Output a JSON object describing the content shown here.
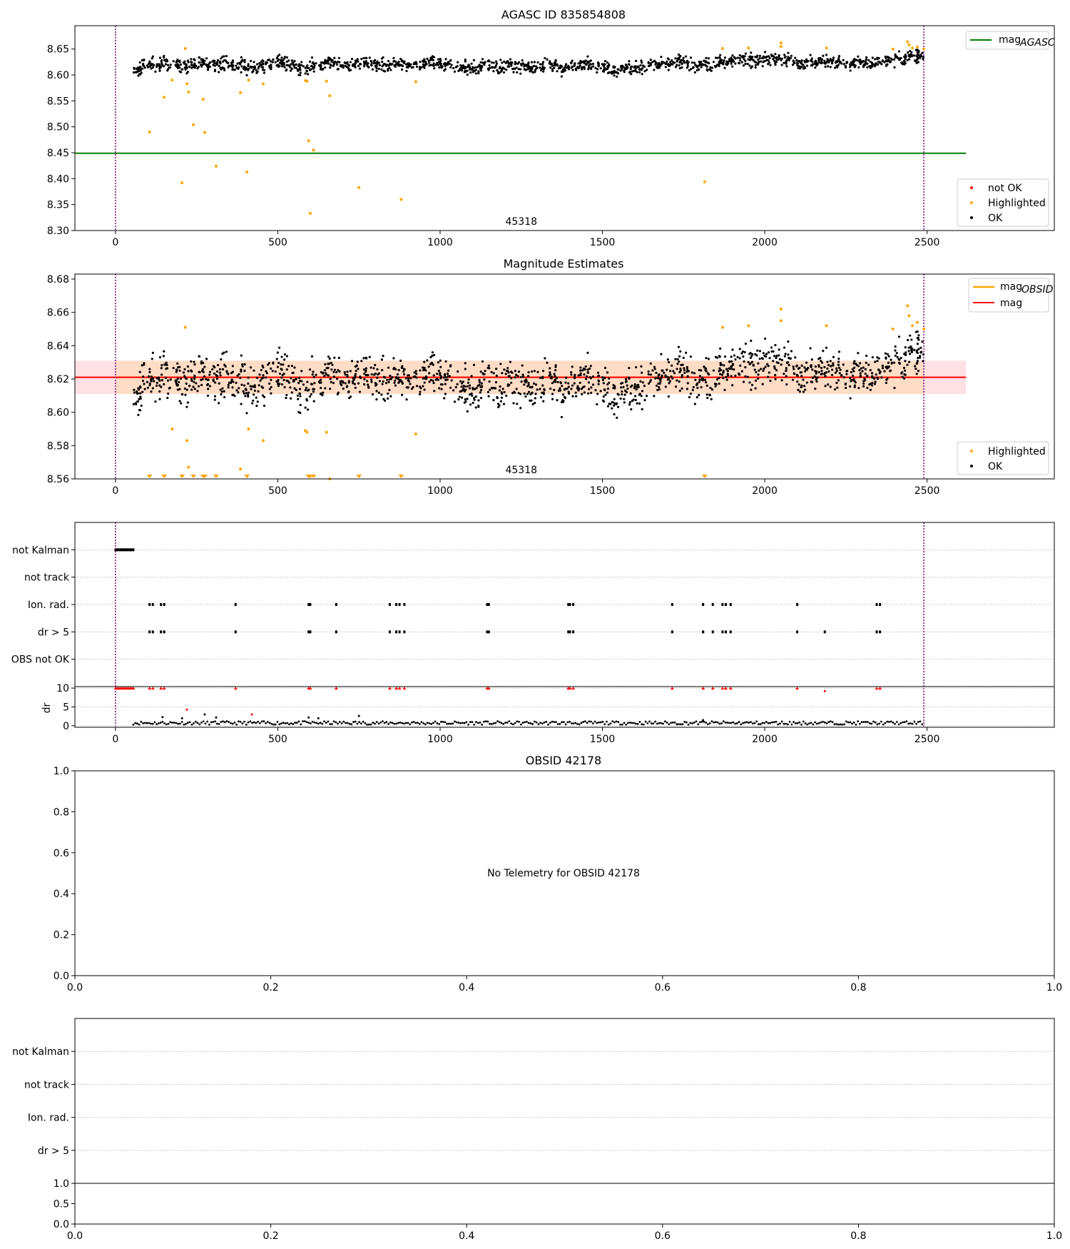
{
  "colors": {
    "ok": "#000000",
    "highlighted": "#ffa500",
    "not_ok": "#ff0000",
    "agasc_line": "#008000",
    "mag_line": "#ff0000",
    "mag_obsid_line": "#ffa500",
    "mag_band": "#ffe0e4",
    "obsid_band": "#ffdcc6",
    "marker_lines": "#800080"
  },
  "chart_data": [
    {
      "type": "scatter",
      "title": "AGASC ID 835854808",
      "annotation": "45318",
      "xlim": [
        -125,
        2892
      ],
      "ylim": [
        8.3,
        8.695
      ],
      "xticks": [
        "0",
        "500",
        "1000",
        "1500",
        "2000",
        "2500"
      ],
      "yticks": [
        "8.30",
        "8.35",
        "8.40",
        "8.45",
        "8.50",
        "8.55",
        "8.60",
        "8.65"
      ],
      "vlines": [
        0,
        2490
      ],
      "hline": {
        "name": "mag_AGASC",
        "label_main": "mag",
        "label_sub": "AGASC",
        "y": 8.449,
        "x": [
          -125,
          2620
        ]
      },
      "legend_points": [
        "not OK",
        "Highlighted",
        "OK"
      ],
      "legend_placement": [
        "top-right",
        "bottom-right"
      ]
    },
    {
      "type": "scatter",
      "title": "Magnitude Estimates",
      "annotation": "45318",
      "xlim": [
        -125,
        2892
      ],
      "ylim": [
        8.56,
        8.683
      ],
      "xticks": [
        "0",
        "500",
        "1000",
        "1500",
        "2000",
        "2500"
      ],
      "yticks": [
        "8.56",
        "8.58",
        "8.60",
        "8.62",
        "8.64",
        "8.66",
        "8.68"
      ],
      "vlines": [
        0,
        2490
      ],
      "mag": {
        "label": "mag",
        "value": 8.621,
        "band": [
          8.611,
          8.631
        ],
        "x": [
          -125,
          2620
        ]
      },
      "mag_obsid": {
        "label_main": "mag",
        "label_sub": "OBSID",
        "value": 8.621,
        "band": [
          8.611,
          8.631
        ],
        "x": [
          0,
          2490
        ]
      },
      "legend_points": [
        "Highlighted",
        "OK"
      ],
      "legend_placement": [
        "top-right",
        "bottom-right"
      ]
    },
    {
      "type": "scatter",
      "title": "",
      "categories": [
        "not Kalman",
        "not track",
        "Ion. rad.",
        "dr > 5",
        "OBS not OK"
      ],
      "xlim": [
        -125,
        2892
      ],
      "xticks": [
        "0",
        "500",
        "1000",
        "1500",
        "2000",
        "2500"
      ],
      "vlines": [
        0,
        2490
      ],
      "flags": {
        "not Kalman": [
          0,
          5,
          10,
          15,
          20,
          25,
          30,
          35,
          40,
          45,
          50,
          55
        ],
        "not track": [],
        "Ion. rad.": [
          105,
          115,
          140,
          150,
          370,
          595,
          600,
          680,
          845,
          865,
          875,
          890,
          1145,
          1150,
          1395,
          1400,
          1410,
          1715,
          1810,
          1840,
          1870,
          1880,
          1895,
          2100,
          2345,
          2355
        ],
        "dr > 5": [
          105,
          115,
          140,
          150,
          370,
          595,
          600,
          680,
          845,
          865,
          875,
          890,
          1145,
          1150,
          1395,
          1400,
          1410,
          1715,
          1810,
          1840,
          1870,
          1880,
          1895,
          2100,
          2185,
          2345,
          2355
        ],
        "OBS not OK": []
      },
      "dr": {
        "ylabel": "dr",
        "ylim": [
          -0.4,
          10.4
        ],
        "yticks": [
          "0",
          "5",
          "10"
        ],
        "ok_points": [
          [
            145,
            2.3
          ],
          [
            205,
            2.0
          ],
          [
            275,
            3.0
          ],
          [
            310,
            2.2
          ],
          [
            595,
            2.2
          ],
          [
            625,
            2.0
          ],
          [
            750,
            2.6
          ],
          [
            1810,
            1.5
          ]
        ],
        "not_ok_points": [
          [
            220,
            4.3
          ],
          [
            420,
            3.0
          ],
          [
            2185,
            9.2
          ]
        ],
        "not_ok_at_max_x": [
          0,
          5,
          10,
          15,
          20,
          25,
          30,
          35,
          40,
          45,
          50,
          55,
          105,
          115,
          140,
          150,
          370,
          595,
          600,
          680,
          845,
          865,
          875,
          890,
          1145,
          1150,
          1395,
          1400,
          1410,
          1715,
          1810,
          1840,
          1870,
          1880,
          1895,
          2100,
          2345,
          2355
        ]
      }
    },
    {
      "type": "scatter",
      "title": "OBSID 42178",
      "annotation": "No Telemetry for OBSID 42178",
      "xlim": [
        0,
        1
      ],
      "ylim": [
        0,
        1
      ],
      "xticks": [
        "0.0",
        "0.2",
        "0.4",
        "0.6",
        "0.8",
        "1.0"
      ],
      "yticks": [
        "0.0",
        "0.2",
        "0.4",
        "0.6",
        "0.8",
        "1.0"
      ]
    },
    {
      "type": "scatter",
      "title": "",
      "categories": [
        "not Kalman",
        "not track",
        "Ion. rad.",
        "dr > 5"
      ],
      "sub": {
        "xlim": [
          0,
          1
        ],
        "ylim": [
          0,
          1
        ],
        "xticks": [
          "0.0",
          "0.2",
          "0.4",
          "0.6",
          "0.8",
          "1.0"
        ],
        "yticks": [
          "0.0",
          "0.5",
          "1.0"
        ]
      }
    }
  ],
  "series": {
    "ok": {
      "name": "OK",
      "x": [
        60,
        100,
        140,
        180,
        220,
        260,
        300,
        340,
        380,
        420,
        460,
        500,
        540,
        580,
        620,
        660,
        700,
        740,
        780,
        820,
        860,
        900,
        940,
        980,
        1020,
        1060,
        1100,
        1140,
        1180,
        1220,
        1260,
        1300,
        1340,
        1380,
        1420,
        1460,
        1500,
        1540,
        1580,
        1620,
        1660,
        1700,
        1740,
        1780,
        1820,
        1860,
        1900,
        1940,
        1980,
        2020,
        2060,
        2100,
        2140,
        2180,
        2220,
        2260,
        2300,
        2340,
        2380,
        2420,
        2460,
        2485
      ],
      "y": [
        8.61,
        8.62,
        8.622,
        8.62,
        8.618,
        8.622,
        8.62,
        8.622,
        8.62,
        8.612,
        8.618,
        8.625,
        8.62,
        8.612,
        8.618,
        8.622,
        8.618,
        8.62,
        8.622,
        8.62,
        8.622,
        8.62,
        8.618,
        8.625,
        8.622,
        8.615,
        8.612,
        8.618,
        8.615,
        8.62,
        8.618,
        8.615,
        8.62,
        8.612,
        8.618,
        8.62,
        8.615,
        8.61,
        8.612,
        8.615,
        8.618,
        8.622,
        8.625,
        8.618,
        8.62,
        8.625,
        8.628,
        8.63,
        8.628,
        8.63,
        8.628,
        8.622,
        8.625,
        8.628,
        8.625,
        8.622,
        8.625,
        8.622,
        8.628,
        8.632,
        8.64,
        8.635
      ]
    },
    "highlighted": {
      "name": "Highlighted",
      "x": [
        105,
        150,
        175,
        205,
        215,
        220,
        225,
        240,
        270,
        275,
        310,
        385,
        405,
        410,
        455,
        585,
        590,
        595,
        600,
        610,
        650,
        660,
        750,
        880,
        925,
        1815,
        1870,
        1950,
        2050,
        2050,
        2190,
        2395,
        2440,
        2445,
        2455,
        2470,
        2490
      ],
      "y": [
        8.49,
        8.557,
        8.59,
        8.392,
        8.651,
        8.583,
        8.567,
        8.504,
        8.553,
        8.489,
        8.424,
        8.566,
        8.413,
        8.59,
        8.583,
        8.589,
        8.588,
        8.473,
        8.333,
        8.455,
        8.588,
        8.56,
        8.383,
        8.36,
        8.587,
        8.394,
        8.651,
        8.652,
        8.662,
        8.655,
        8.652,
        8.65,
        8.664,
        8.658,
        8.652,
        8.654,
        8.65
      ]
    },
    "not_ok": {
      "name": "not OK",
      "x": [],
      "y": []
    }
  }
}
